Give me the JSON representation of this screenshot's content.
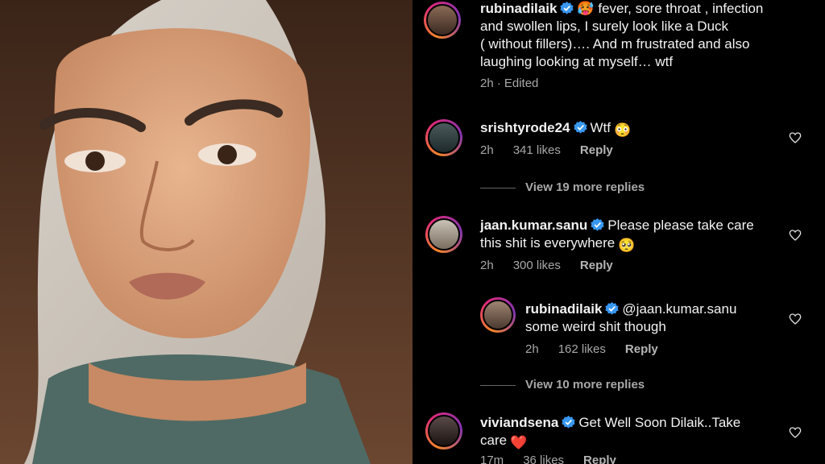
{
  "post": {
    "username": "rubinadilaik",
    "emoji": "🥵",
    "caption_line1": "fever, sore throat , infection",
    "caption_line2": "and swollen lips, I surely look like a Duck",
    "caption_line3": "( without fillers)…. And m frustrated and also",
    "caption_line4": "laughing looking at myself… wtf",
    "time": "2h",
    "edited": "· Edited"
  },
  "comments": [
    {
      "username": "srishtyrode24",
      "text": "Wtf",
      "emoji": "😳",
      "time": "2h",
      "likes": "341 likes",
      "reply": "Reply",
      "view_more": "View 19 more replies"
    },
    {
      "username": "jaan.kumar.sanu",
      "text_line1": "Please please take care",
      "text_line2": "this shit is everywhere",
      "emoji": "🥺",
      "time": "2h",
      "likes": "300 likes",
      "reply": "Reply"
    },
    {
      "username": "rubinadilaik",
      "text_line1": "@jaan.kumar.sanu",
      "text_line2": "some weird shit though",
      "time": "2h",
      "likes": "162 likes",
      "reply": "Reply",
      "view_more": "View 10 more replies"
    },
    {
      "username": "viviandsena",
      "text_line1": "Get Well Soon Dilaik..Take",
      "text_line2": "care",
      "emoji": "❤️",
      "time": "17m",
      "likes": "36 likes",
      "reply": "Reply"
    }
  ],
  "colors": {
    "verified": "#3897f0",
    "meta": "#a8a8a8",
    "background": "#000000"
  },
  "icons": [
    "verified-badge-icon",
    "heart-icon"
  ]
}
